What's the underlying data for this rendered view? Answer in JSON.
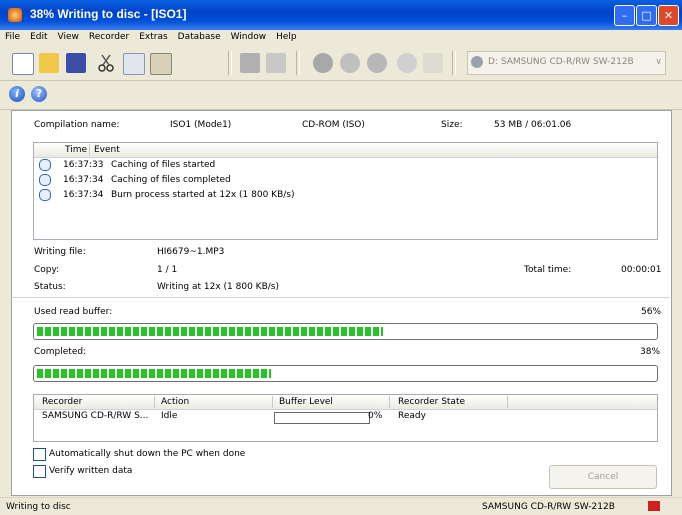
{
  "window": {
    "title": "38% Writing to disc - [ISO1]"
  },
  "menu": [
    "File",
    "Edit",
    "View",
    "Recorder",
    "Extras",
    "Database",
    "Window",
    "Help"
  ],
  "toolbar": {
    "drive": "D: SAMSUNG  CD-R/RW SW-212B"
  },
  "compilation": {
    "name_label": "Compilation name:",
    "name_value": "ISO1 (Mode1)",
    "type": "CD-ROM (ISO)",
    "size_label": "Size:",
    "size_value": "53 MB  /  06:01.06"
  },
  "log": {
    "columns": [
      "Time",
      "Event"
    ],
    "rows": [
      {
        "time": "16:37:33",
        "event": "Caching of files started"
      },
      {
        "time": "16:37:34",
        "event": "Caching of files completed"
      },
      {
        "time": "16:37:34",
        "event": "Burn process started at 12x (1 800 KB/s)"
      }
    ]
  },
  "details": {
    "writing_file_label": "Writing file:",
    "writing_file": "HI6679~1.MP3",
    "copy_label": "Copy:",
    "copy": "1 / 1",
    "total_time_label": "Total time:",
    "total_time": "00:00:01",
    "status_label": "Status:",
    "status": "Writing at 12x (1 800 KB/s)"
  },
  "buffer": {
    "label": "Used read buffer:",
    "percent_text": "56%",
    "fraction": 0.56
  },
  "completed": {
    "label": "Completed:",
    "percent_text": "38%",
    "fraction": 0.38
  },
  "recorders": {
    "columns": [
      "Recorder",
      "Action",
      "Buffer Level",
      "Recorder State"
    ],
    "rows": [
      {
        "recorder": "SAMSUNG CD-R/RW S...",
        "action": "Idle",
        "buffer": "0%",
        "state": "Ready"
      }
    ]
  },
  "options": {
    "shutdown": "Automatically shut down the PC when done",
    "verify": "Verify written data"
  },
  "buttons": {
    "cancel": "Cancel"
  },
  "statusbar": {
    "left": "Writing to disc",
    "right": "SAMSUNG  CD-R/RW SW-212B"
  },
  "colors": {
    "progress": "#27c427",
    "titlebar": "#0050d8"
  }
}
